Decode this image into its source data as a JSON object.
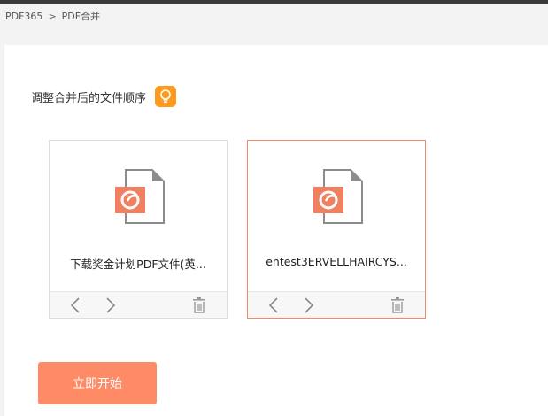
{
  "breadcrumb": {
    "root": "PDF365",
    "separator": ">",
    "current": "PDF合并"
  },
  "instruction": {
    "text": "调整合并后的文件顺序",
    "icon": "lightbulb-icon"
  },
  "files": [
    {
      "name": "下载奖金计划PDF文件(英...",
      "icon": "pdf-file-icon",
      "selected": false
    },
    {
      "name": "entest3ERVELLHAIRCYS...",
      "icon": "pdf-file-icon",
      "selected": true
    }
  ],
  "card_controls": {
    "prev_icon": "chevron-left-icon",
    "next_icon": "chevron-right-icon",
    "delete_icon": "trash-icon"
  },
  "actions": {
    "start_label": "立即开始"
  },
  "colors": {
    "accent": "#ff8b66",
    "selected_border": "#f08a6a",
    "tip_badge": "#ff9a1f",
    "file_badge": "#f08060"
  }
}
